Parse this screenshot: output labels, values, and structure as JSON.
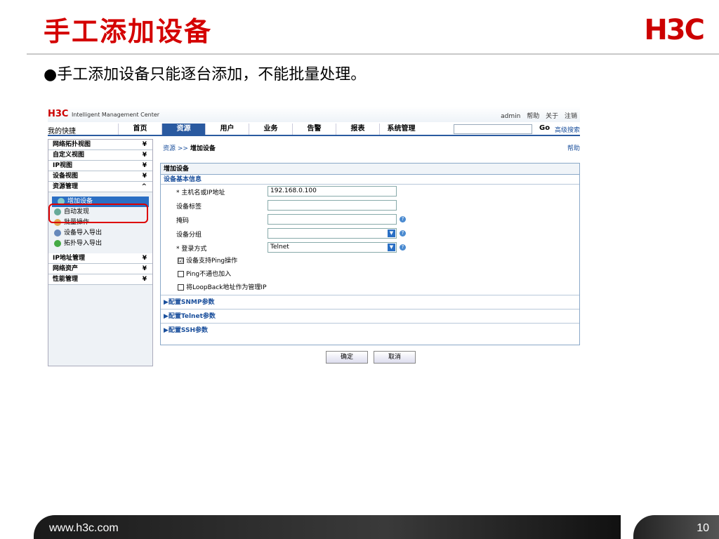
{
  "slide": {
    "title": "手工添加设备",
    "logo": "H3C",
    "bullet": "●手工添加设备只能逐台添加，不能批量处理。",
    "footer_url": "www.h3c.com",
    "page_number": "10"
  },
  "app": {
    "logo": "H3C",
    "logo_sub": "Intelligent Management Center",
    "top_links": [
      "admin",
      "帮助",
      "关于",
      "注销"
    ],
    "shortcut": "我的快捷",
    "nav_tabs": [
      "首页",
      "资源",
      "用户",
      "业务",
      "告警",
      "报表",
      "系统管理"
    ],
    "active_tab": "资源",
    "go_label": "Go",
    "advanced_search": "高级搜索"
  },
  "sidebar": {
    "items_top": [
      "网络拓扑视图",
      "自定义视图",
      "IP视图",
      "设备视图",
      "资源管理"
    ],
    "sub_items": [
      "增加设备",
      "自动发现",
      "批量操作",
      "设备导入导出",
      "拓扑导入导出"
    ],
    "items_bottom": [
      "IP地址管理",
      "网络资产",
      "性能管理"
    ]
  },
  "main": {
    "breadcrumb_root": "资源",
    "breadcrumb_sep": ">>",
    "breadcrumb_page": "增加设备",
    "help": "帮助",
    "panel_title": "增加设备",
    "section_title": "设备基本信息",
    "fields": [
      {
        "label": "* 主机名或IP地址",
        "value": "192.168.0.100"
      },
      {
        "label": "设备标签",
        "value": ""
      },
      {
        "label": "掩码",
        "value": ""
      },
      {
        "label": "设备分组",
        "value": ""
      },
      {
        "label": "* 登录方式",
        "value": "Telnet"
      }
    ],
    "checkboxes": [
      {
        "label": "设备支持Ping操作",
        "checked": "☑"
      },
      {
        "label": "Ping不通也加入",
        "checked": ""
      },
      {
        "label": "将LoopBack地址作为管理IP",
        "checked": ""
      }
    ],
    "collapsibles": [
      "配置SNMP参数",
      "配置Telnet参数",
      "配置SSH参数"
    ],
    "ok": "确定",
    "cancel": "取消"
  }
}
